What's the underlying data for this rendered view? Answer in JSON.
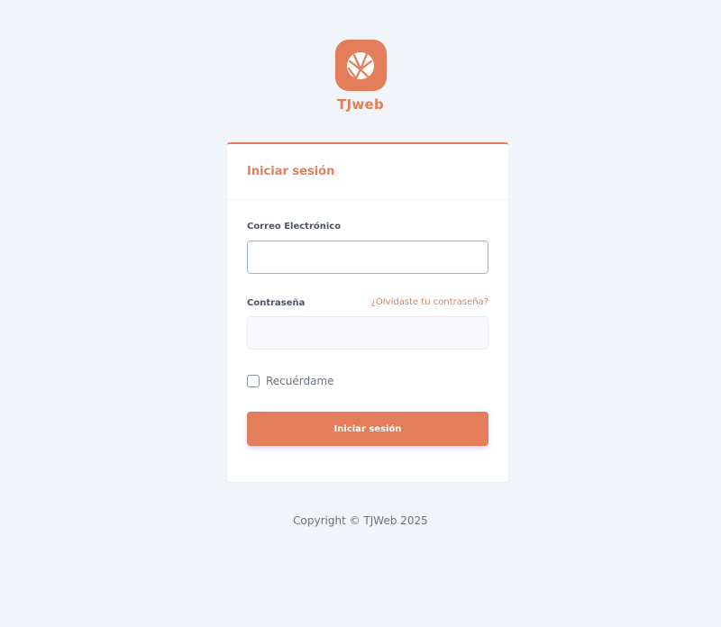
{
  "brand": {
    "name": "TJweb",
    "icon": "globe-icon",
    "color": "#e47d59"
  },
  "login": {
    "title": "Iniciar sesión",
    "email_label": "Correo Electrónico",
    "email_value": "",
    "password_label": "Contraseña",
    "password_value": "",
    "forgot_link": "¿Olvidaste tu contraseña?",
    "remember_label": "Recuérdame",
    "remember_checked": false,
    "submit_label": "Iniciar sesión"
  },
  "footer": {
    "copyright": "Copyright © TJWeb 2025"
  },
  "colors": {
    "accent": "#e47d59",
    "background": "#f1f5f9",
    "card": "#ffffff"
  }
}
